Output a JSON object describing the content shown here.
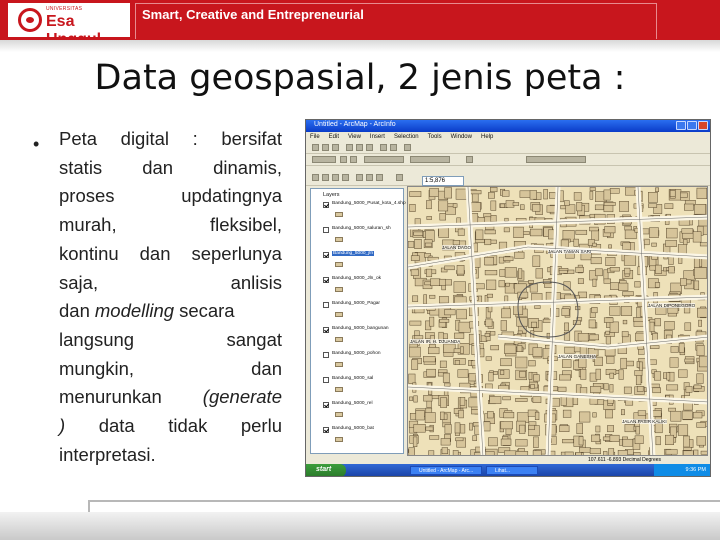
{
  "header": {
    "logo_small": "UNIVERSITAS",
    "logo_text": "Esa Unggul",
    "tagline": "Smart, Creative and Entrepreneurial"
  },
  "slide": {
    "title": "Data geospasial, 2 jenis peta :",
    "bullet_symbol": "•",
    "bullet_lines": [
      [
        "Peta",
        "digital",
        ":",
        "bersifat"
      ],
      [
        "statis",
        "dan",
        "dinamis,"
      ],
      [
        "proses",
        "updatingnya"
      ],
      [
        "murah,",
        "fleksibel,"
      ],
      [
        "kontinu",
        "dan",
        "seperlunya"
      ],
      [
        "saja,",
        "anlisis"
      ],
      [
        "dan",
        "modelling",
        "secara"
      ],
      [
        "langsung",
        "sangat"
      ],
      [
        "mungkin,",
        "dan"
      ],
      [
        "menurunkan",
        "(generate"
      ],
      [
        ")",
        "data",
        "tidak",
        "perlu"
      ],
      [
        "interpretasi."
      ]
    ]
  },
  "arcmap": {
    "window_title": "Untitled - ArcMap - ArcInfo",
    "menu": [
      "File",
      "Edit",
      "View",
      "Insert",
      "Selection",
      "Tools",
      "Window",
      "Help"
    ],
    "scale": "1:5,876",
    "toc_title": "Layers",
    "layers": [
      {
        "name": "Bandung_5000_Pusat_kota_4.shp",
        "checked": true,
        "selected": false
      },
      {
        "name": "Bandung_5000_saluran_sh",
        "checked": false,
        "selected": false
      },
      {
        "name": "Bandung_5000_jln",
        "checked": true,
        "selected": true
      },
      {
        "name": "Bandung_5000_Jln_ok",
        "checked": true,
        "selected": false
      },
      {
        "name": "Bandung_5000_Pagar",
        "checked": false,
        "selected": false
      },
      {
        "name": "Bandung_5000_bangunan",
        "checked": true,
        "selected": false
      },
      {
        "name": "Bandung_5000_pohon",
        "checked": false,
        "selected": false
      },
      {
        "name": "Bandung_5000_sal",
        "checked": false,
        "selected": false
      },
      {
        "name": "Bandung_5000_rel",
        "checked": true,
        "selected": false
      },
      {
        "name": "Bandung_5000_bat",
        "checked": true,
        "selected": false
      }
    ],
    "map_labels": [
      "JALAN DAGO",
      "JALAN IR. H. DJUANDA",
      "JALAN TAMAN SARI",
      "JALAN GANESHA",
      "JALAN PASIR KALIKI",
      "JALAN DIPONEGORO"
    ],
    "status_coord": "107.611 -6.893 Decimal Degrees",
    "taskbar": {
      "start": "start",
      "items": [
        "Untitled - ArcMap - Arc...",
        "Lihat..."
      ],
      "clock": "9:36 PM"
    }
  }
}
